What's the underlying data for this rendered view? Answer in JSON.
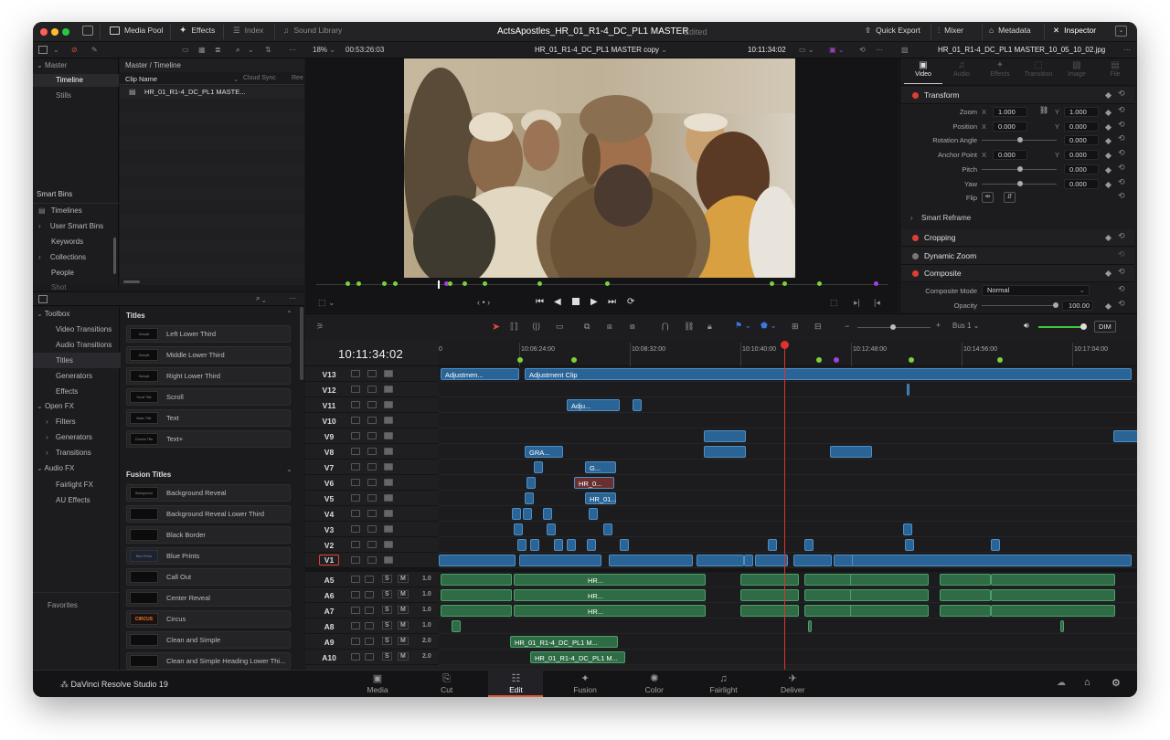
{
  "titlebar": {
    "media_pool": "Media Pool",
    "effects": "Effects",
    "index": "Index",
    "sound_library": "Sound Library",
    "project_title": "ActsApostles_HR_01_R1-4_DC_PL1 MASTER",
    "edited": "Edited",
    "quick_export": "Quick Export",
    "mixer": "Mixer",
    "metadata": "Metadata",
    "inspector": "Inspector"
  },
  "viewer_bar": {
    "zoom": "18%",
    "source_tc": "00:53:26:03",
    "timeline_name": "HR_01_R1-4_DC_PL1 MASTER copy",
    "record_tc": "10:11:34:02",
    "inspector_file": "HR_01_R1-4_DC_PL1 MASTER_10_05_10_02.jpg"
  },
  "media_pool": {
    "bins": [
      "Master",
      "Timeline",
      "Stills"
    ],
    "breadcrumb": "Master / Timeline",
    "columns": [
      "Clip Name",
      "Cloud Sync",
      "Ree"
    ],
    "clips": [
      "HR_01_R1-4_DC_PL1 MASTE..."
    ],
    "smart_bins_label": "Smart Bins",
    "smart_bins": [
      "Timelines",
      "User Smart Bins",
      "Keywords",
      "Collections",
      "People",
      "Shot"
    ]
  },
  "toolbox": {
    "items": [
      "Toolbox",
      "Video Transitions",
      "Audio Transitions",
      "Titles",
      "Generators",
      "Effects",
      "Open FX",
      "Filters",
      "Generators",
      "Transitions",
      "Audio FX",
      "Fairlight FX",
      "AU Effects"
    ],
    "favorites": "Favorites"
  },
  "titles": {
    "header": "Titles",
    "items": [
      {
        "name": "Left Lower Third",
        "thumb": "Sample"
      },
      {
        "name": "Middle Lower Third",
        "thumb": "Sample"
      },
      {
        "name": "Right Lower Third",
        "thumb": "Sample"
      },
      {
        "name": "Scroll",
        "thumb": "Scroll Title"
      },
      {
        "name": "Text",
        "thumb": "Basic Title"
      },
      {
        "name": "Text+",
        "thumb": "Custom Title"
      }
    ],
    "fusion_header": "Fusion Titles",
    "fusion_items": [
      {
        "name": "Background Reveal",
        "thumb": "Background Reveal"
      },
      {
        "name": "Background Reveal Lower Third",
        "thumb": ""
      },
      {
        "name": "Black Border",
        "thumb": ""
      },
      {
        "name": "Blue Prints",
        "thumb": "Blue Prints"
      },
      {
        "name": "Call Out",
        "thumb": ""
      },
      {
        "name": "Center Reveal",
        "thumb": ""
      },
      {
        "name": "Circus",
        "thumb": "CIRCUS"
      },
      {
        "name": "Clean and Simple",
        "thumb": ""
      },
      {
        "name": "Clean and Simple Heading Lower Thi...",
        "thumb": ""
      }
    ]
  },
  "inspector": {
    "tabs": [
      "Video",
      "Audio",
      "Effects",
      "Transition",
      "Image",
      "File"
    ],
    "transform_label": "Transform",
    "zoom": {
      "label": "Zoom",
      "x": "1.000",
      "y": "1.000"
    },
    "position": {
      "label": "Position",
      "x": "0.000",
      "y": "0.000"
    },
    "rotation": {
      "label": "Rotation Angle",
      "value": "0.000"
    },
    "anchor": {
      "label": "Anchor Point",
      "x": "0.000",
      "y": "0.000"
    },
    "pitch": {
      "label": "Pitch",
      "value": "0.000"
    },
    "yaw": {
      "label": "Yaw",
      "value": "0.000"
    },
    "flip": "Flip",
    "smart_reframe": "Smart Reframe",
    "cropping": "Cropping",
    "dynamic_zoom": "Dynamic Zoom",
    "composite": "Composite",
    "composite_mode_label": "Composite Mode",
    "composite_mode": "Normal",
    "opacity_label": "Opacity",
    "opacity": "100.00",
    "x": "X",
    "y": "Y"
  },
  "timeline": {
    "timecode": "10:11:34:02",
    "ruler": [
      "10:06:24:00",
      "10:08:32:00",
      "10:10:40:00",
      "10:12:48:00",
      "10:14:56:00",
      "10:17:04:00"
    ],
    "bus": "Bus 1",
    "dim": "DIM",
    "video_tracks": [
      "V13",
      "V12",
      "V11",
      "V10",
      "V9",
      "V8",
      "V7",
      "V6",
      "V5",
      "V4",
      "V3",
      "V2",
      "V1"
    ],
    "audio_tracks": [
      {
        "name": "A5",
        "level": "1.0"
      },
      {
        "name": "A6",
        "level": "1.0"
      },
      {
        "name": "A7",
        "level": "1.0"
      },
      {
        "name": "A8",
        "level": "1.0"
      },
      {
        "name": "A9",
        "level": "2.0"
      },
      {
        "name": "A10",
        "level": "2.0"
      }
    ],
    "clip_labels": {
      "adj1": "Adjustmen...",
      "adj2": "Adjustment Clip",
      "adj3": "Adju...",
      "gra": "GRA...",
      "g": "G...",
      "hr1": "HR_0...",
      "hr2": "HR_01...",
      "a5": "HR...",
      "a6": "HR...",
      "a7": "HR...",
      "a9": "HR_01_R1-4_DC_PL1 M...",
      "a10": "HR_01_R1-4_DC_PL1 M..."
    },
    "s": "S",
    "m": "M"
  },
  "footer": {
    "app": "DaVinci Resolve Studio 19",
    "pages": [
      "Media",
      "Cut",
      "Edit",
      "Fusion",
      "Color",
      "Fairlight",
      "Deliver"
    ],
    "active_page": "Edit"
  }
}
